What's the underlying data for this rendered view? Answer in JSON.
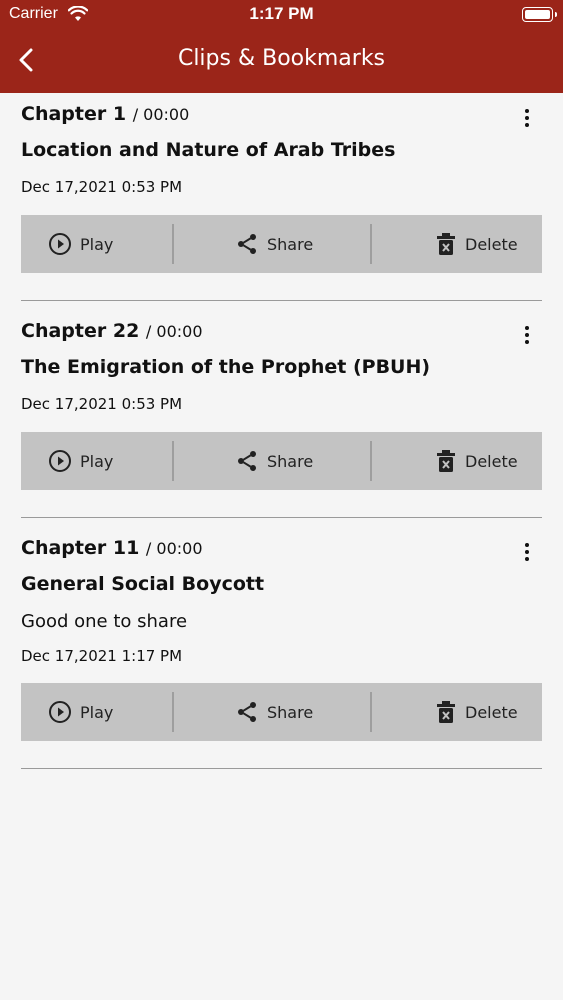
{
  "status": {
    "carrier": "Carrier",
    "time": "1:17 PM"
  },
  "header": {
    "title": "Clips & Bookmarks",
    "back_icon": "chevron-left-icon"
  },
  "colors": {
    "header_bg": "#9b2519",
    "action_bar_bg": "#c3c3c3",
    "page_bg": "#f5f5f5"
  },
  "actions": {
    "play": "Play",
    "share": "Share",
    "delete": "Delete"
  },
  "clips": [
    {
      "chapter": "Chapter 1",
      "time": "/ 00:00",
      "title": "Location and Nature of Arab Tribes",
      "note": "",
      "date": "Dec 17,2021 0:53 PM"
    },
    {
      "chapter": "Chapter 22",
      "time": "/ 00:00",
      "title": "The Emigration of the Prophet (PBUH)",
      "note": "",
      "date": "Dec 17,2021 0:53 PM"
    },
    {
      "chapter": "Chapter 11",
      "time": "/ 00:00",
      "title": "General Social Boycott",
      "note": "Good one to share",
      "date": "Dec 17,2021 1:17 PM"
    }
  ]
}
